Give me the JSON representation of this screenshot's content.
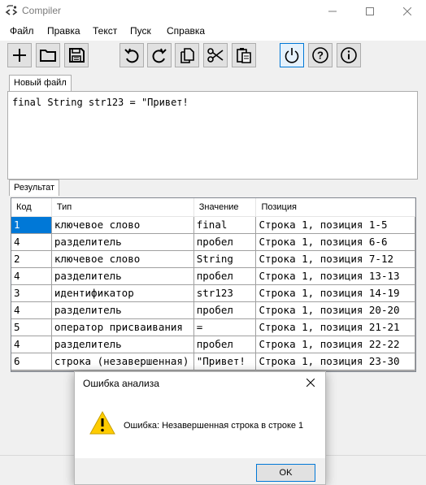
{
  "window": {
    "title": "Compiler"
  },
  "menu": {
    "items": [
      "Файл",
      "Правка",
      "Текст",
      "Пуск",
      "Справка"
    ]
  },
  "toolbar": {
    "buttons": [
      {
        "name": "new-icon"
      },
      {
        "name": "open-icon"
      },
      {
        "name": "save-icon"
      },
      {
        "name": "undo-icon"
      },
      {
        "name": "redo-icon"
      },
      {
        "name": "copy-icon"
      },
      {
        "name": "cut-icon"
      },
      {
        "name": "paste-icon"
      },
      {
        "name": "run-icon"
      },
      {
        "name": "help-icon"
      },
      {
        "name": "info-icon"
      }
    ]
  },
  "editor": {
    "tab_label": "Новый файл",
    "text": "final String str123 = \"Привет!"
  },
  "result": {
    "tab_label": "Результат",
    "columns": [
      "Код",
      "Тип",
      "Значение",
      "Позиция"
    ],
    "rows": [
      [
        "1",
        "ключевое слово",
        "final",
        "Строка 1, позиция 1-5"
      ],
      [
        "4",
        "разделитель",
        "пробел",
        "Строка 1, позиция 6-6"
      ],
      [
        "2",
        "ключевое слово",
        "String",
        "Строка 1, позиция 7-12"
      ],
      [
        "4",
        "разделитель",
        "пробел",
        "Строка 1, позиция 13-13"
      ],
      [
        "3",
        "идентификатор",
        "str123",
        "Строка 1, позиция 14-19"
      ],
      [
        "4",
        "разделитель",
        "пробел",
        "Строка 1, позиция 20-20"
      ],
      [
        "5",
        "оператор присваивания",
        "=",
        "Строка 1, позиция 21-21"
      ],
      [
        "4",
        "разделитель",
        "пробел",
        "Строка 1, позиция 22-22"
      ],
      [
        "6",
        "строка (незавершенная)",
        "\"Привет!",
        "Строка 1, позиция 23-30"
      ]
    ]
  },
  "dialog": {
    "title": "Ошибка анализа",
    "message": "Ошибка: Незавершенная строка в строке 1",
    "ok_label": "OK",
    "icon": "warning-icon"
  },
  "colors": {
    "accent": "#0078d7",
    "warning": "#ffcc00"
  }
}
